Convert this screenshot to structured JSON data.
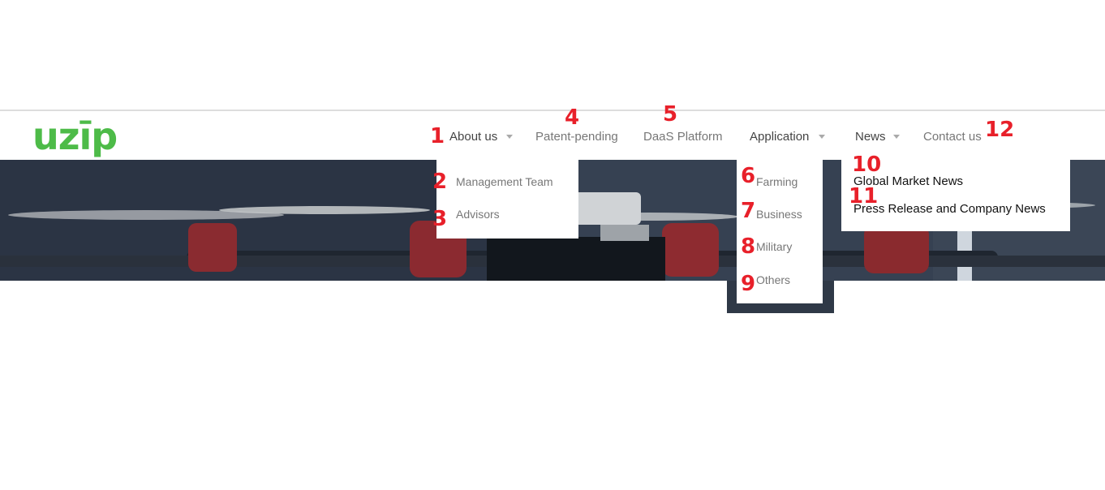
{
  "brand": {
    "logo_text": "uzīp",
    "color": "#4dbb48"
  },
  "nav": {
    "about": "About us",
    "patent": "Patent-pending",
    "daas": "DaaS Platform",
    "application": "Application",
    "news": "News",
    "contact": "Contact us"
  },
  "about_menu": {
    "items": [
      "Management Team",
      "Advisors"
    ]
  },
  "application_menu": {
    "items": [
      "Farming",
      "Business",
      "Military",
      "Others"
    ]
  },
  "news_menu": {
    "items": [
      "Global Market News",
      "Press Release and Company News"
    ]
  },
  "annotations": [
    "1",
    "2",
    "3",
    "4",
    "5",
    "6",
    "7",
    "8",
    "9",
    "10",
    "11",
    "12"
  ],
  "colors": {
    "annotation": "#e8202a",
    "menu_text": "#777777",
    "nav_active": "#444444"
  },
  "icons": {
    "caret": "chevron-down-icon",
    "hero": "drone-hero-image"
  }
}
